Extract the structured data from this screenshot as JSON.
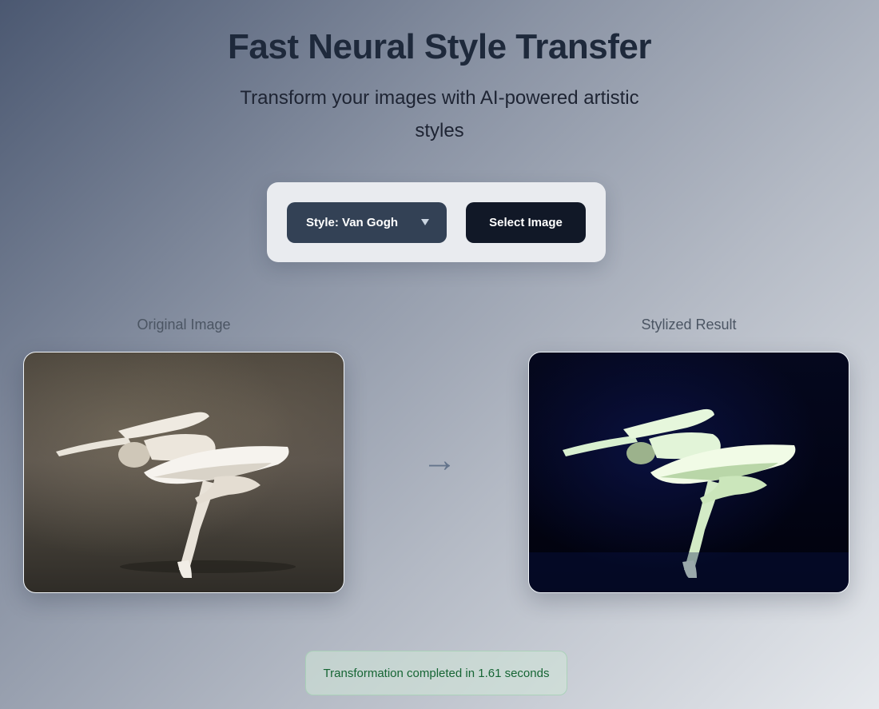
{
  "header": {
    "title": "Fast Neural Style Transfer",
    "subtitle": "Transform your images with AI-powered artistic styles"
  },
  "controls": {
    "style_select_value": "Style: Van Gogh",
    "select_image_label": "Select Image"
  },
  "panels": {
    "original_label": "Original Image",
    "result_label": "Stylized Result"
  },
  "arrow_glyph": "→",
  "status": {
    "message": "Transformation completed in 1.61 seconds"
  },
  "colors": {
    "primary_button": "#111827",
    "select_background": "#334155",
    "status_text": "#166534"
  },
  "icons": {
    "chevron": "chevron-down-icon",
    "arrow": "arrow-right-icon"
  }
}
